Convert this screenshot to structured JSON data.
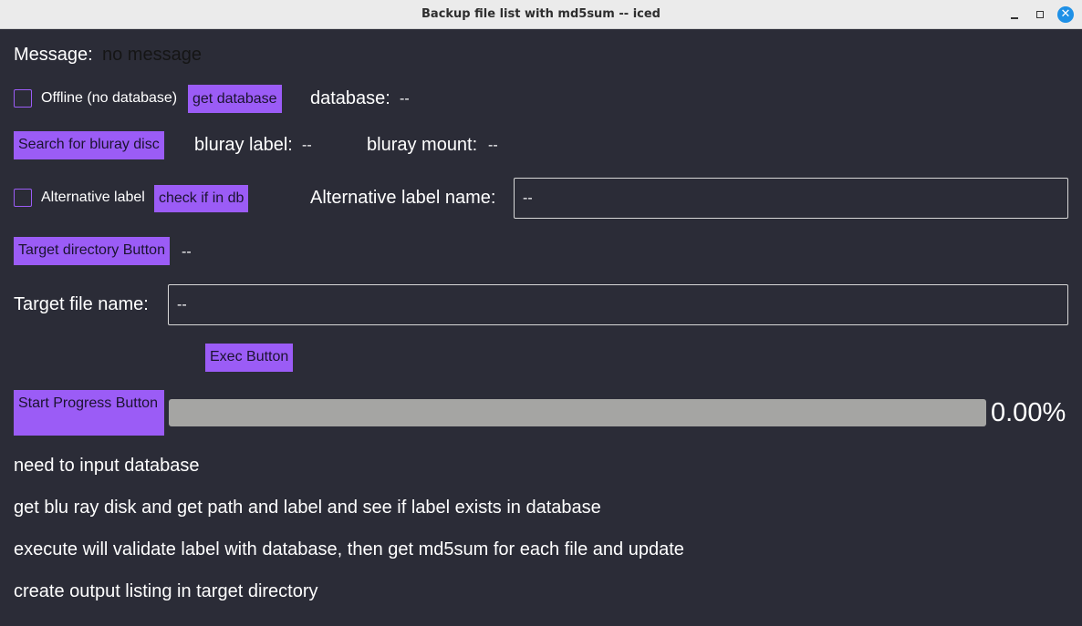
{
  "window": {
    "title": "Backup file list with md5sum -- iced"
  },
  "message": {
    "label": "Message:",
    "value": "no message"
  },
  "offline": {
    "label": "Offline (no database)",
    "checked": false
  },
  "get_database_button": "get database",
  "database": {
    "label": "database:",
    "value": "--"
  },
  "search_bluray_button": "Search for bluray disc",
  "bluray_label": {
    "label": "bluray label:",
    "value": "--"
  },
  "bluray_mount": {
    "label": "bluray mount:",
    "value": "--"
  },
  "alternative_label": {
    "label": "Alternative label",
    "checked": false
  },
  "check_db_button": "check if in db",
  "alternative_label_name": {
    "label": "Alternative label name:",
    "value": "--"
  },
  "target_directory_button": "Target directory Button",
  "target_directory_value": "--",
  "target_file_name": {
    "label": "Target file name:",
    "value": "--"
  },
  "exec_button": "Exec Button",
  "start_progress_button": "Start Progress Button",
  "progress": {
    "fraction": 0.0,
    "text": "0.00%"
  },
  "instructions": [
    "need to input database",
    "get blu ray disk and get path and label and see if label exists in database",
    "execute will validate label with database, then get md5sum for each file and update",
    "create output listing in target directory"
  ],
  "colors": {
    "accent": "#9b5cf6",
    "background": "#2b2c37",
    "progress_track": "#a5a5a3"
  }
}
